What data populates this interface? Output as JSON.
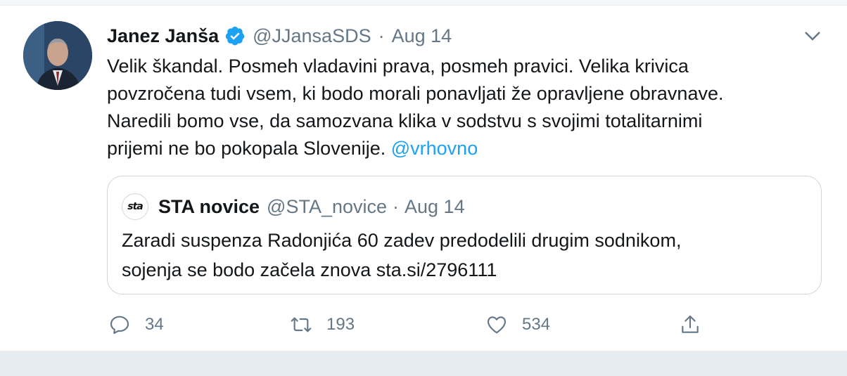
{
  "tweet": {
    "author_name": "Janez Janša",
    "handle": "@JJansaSDS",
    "separator": "·",
    "date": "Aug 14",
    "text_lines": [
      "Velik škandal. Posmeh vladavini prava, posmeh pravici. Velika krivica",
      "povzročena tudi vsem, ki bodo morali ponavljati že opravljene obravnave.",
      "Naredili bomo vse, da samozvana klika v sodstvu s svojimi totalitarnimi",
      "prijemi ne bo pokopala Slovenije. "
    ],
    "mention": "@vrhovno"
  },
  "quoted": {
    "logo_text": "sta",
    "author_name": "STA novice",
    "handle": "@STA_novice",
    "separator": "·",
    "date": "Aug 14",
    "text_lines": [
      "Zaradi suspenza Radonjića 60 zadev predodelili drugim sodnikom,",
      "sojenja se bodo začela znova sta.si/2796111"
    ]
  },
  "actions": {
    "reply_count": "34",
    "retweet_count": "193",
    "like_count": "534"
  },
  "colors": {
    "accent": "#1da1f2",
    "muted": "#657786",
    "text": "#14171a"
  },
  "icons": [
    "verified-badge-icon",
    "chevron-down-icon",
    "reply-icon",
    "retweet-icon",
    "like-icon",
    "share-icon"
  ]
}
